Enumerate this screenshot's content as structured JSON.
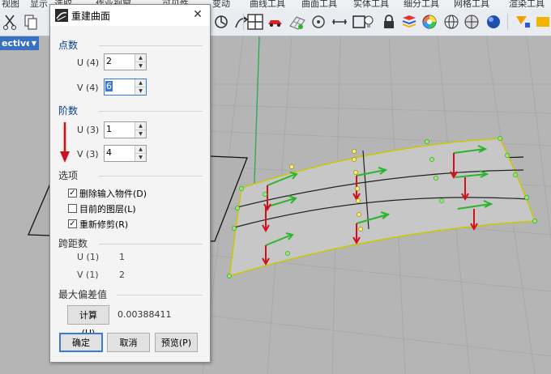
{
  "menubar": {
    "items": [
      "视图",
      "显示",
      "选取",
      "作业视窗",
      "可见性",
      "变动",
      "曲线工具",
      "曲面工具",
      "实体工具",
      "细分工具",
      "网格工具",
      "渲染工具"
    ]
  },
  "viewport": {
    "title": "ective"
  },
  "dialog": {
    "title": "重建曲面",
    "close_glyph": "✕",
    "point_count": {
      "heading": "点数",
      "u_label": "U (4)",
      "u_value": "2",
      "v_label": "V (4)",
      "v_value": "6"
    },
    "degree": {
      "heading": "阶数",
      "u_label": "U (3)",
      "u_value": "1",
      "v_label": "V (3)",
      "v_value": "4"
    },
    "options": {
      "heading": "选项",
      "items": [
        {
          "label": "删除输入物件(D)",
          "checked": true,
          "mark": "✓"
        },
        {
          "label": "目前的图层(L)",
          "checked": false,
          "mark": ""
        },
        {
          "label": "重新修剪(R)",
          "checked": true,
          "mark": "✓"
        }
      ]
    },
    "span": {
      "heading": "跨距数",
      "u_label": "U (1)",
      "u_value": "1",
      "v_label": "V (1)",
      "v_value": "2"
    },
    "deviation": {
      "heading": "最大偏差值",
      "compute_label": "计算(U)",
      "value": "0.00388411"
    },
    "buttons": {
      "ok": "确定",
      "cancel": "取消",
      "preview": "预览(P)"
    }
  },
  "colors": {
    "arrow_red": "#d0101a",
    "surface_edge": "#d8d800",
    "control_point": "#8cf06a",
    "direction_green": "#2bb52b",
    "accent_blue": "#3b79d6"
  }
}
